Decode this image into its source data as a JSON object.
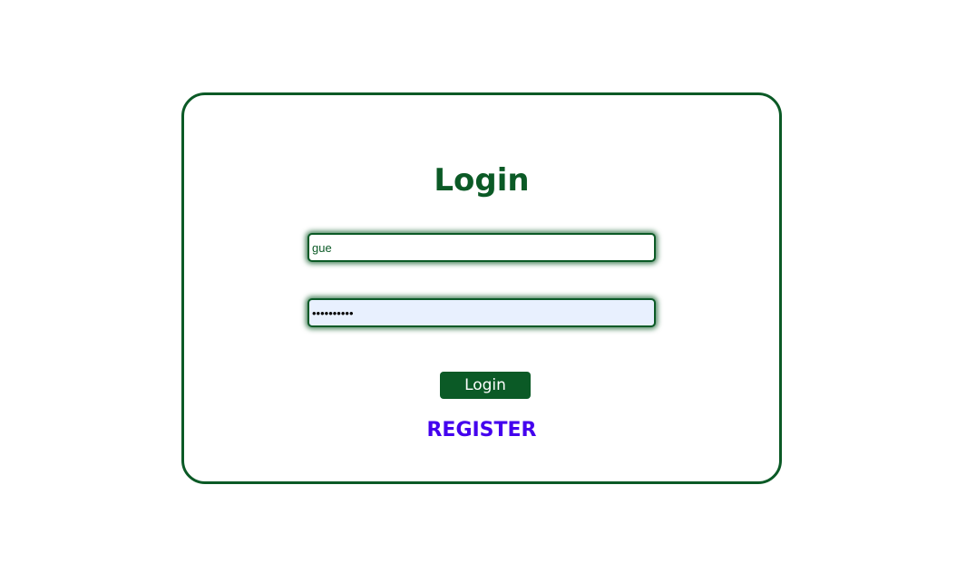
{
  "login_form": {
    "title": "Login",
    "username": {
      "value": "gue"
    },
    "password": {
      "value": "guestuser1"
    },
    "submit_label": "Login",
    "register_label": "REGISTER"
  },
  "colors": {
    "brand_green": "#0b5a26",
    "register_link": "#4400ee",
    "autofill_bg": "#e8f0fe"
  }
}
